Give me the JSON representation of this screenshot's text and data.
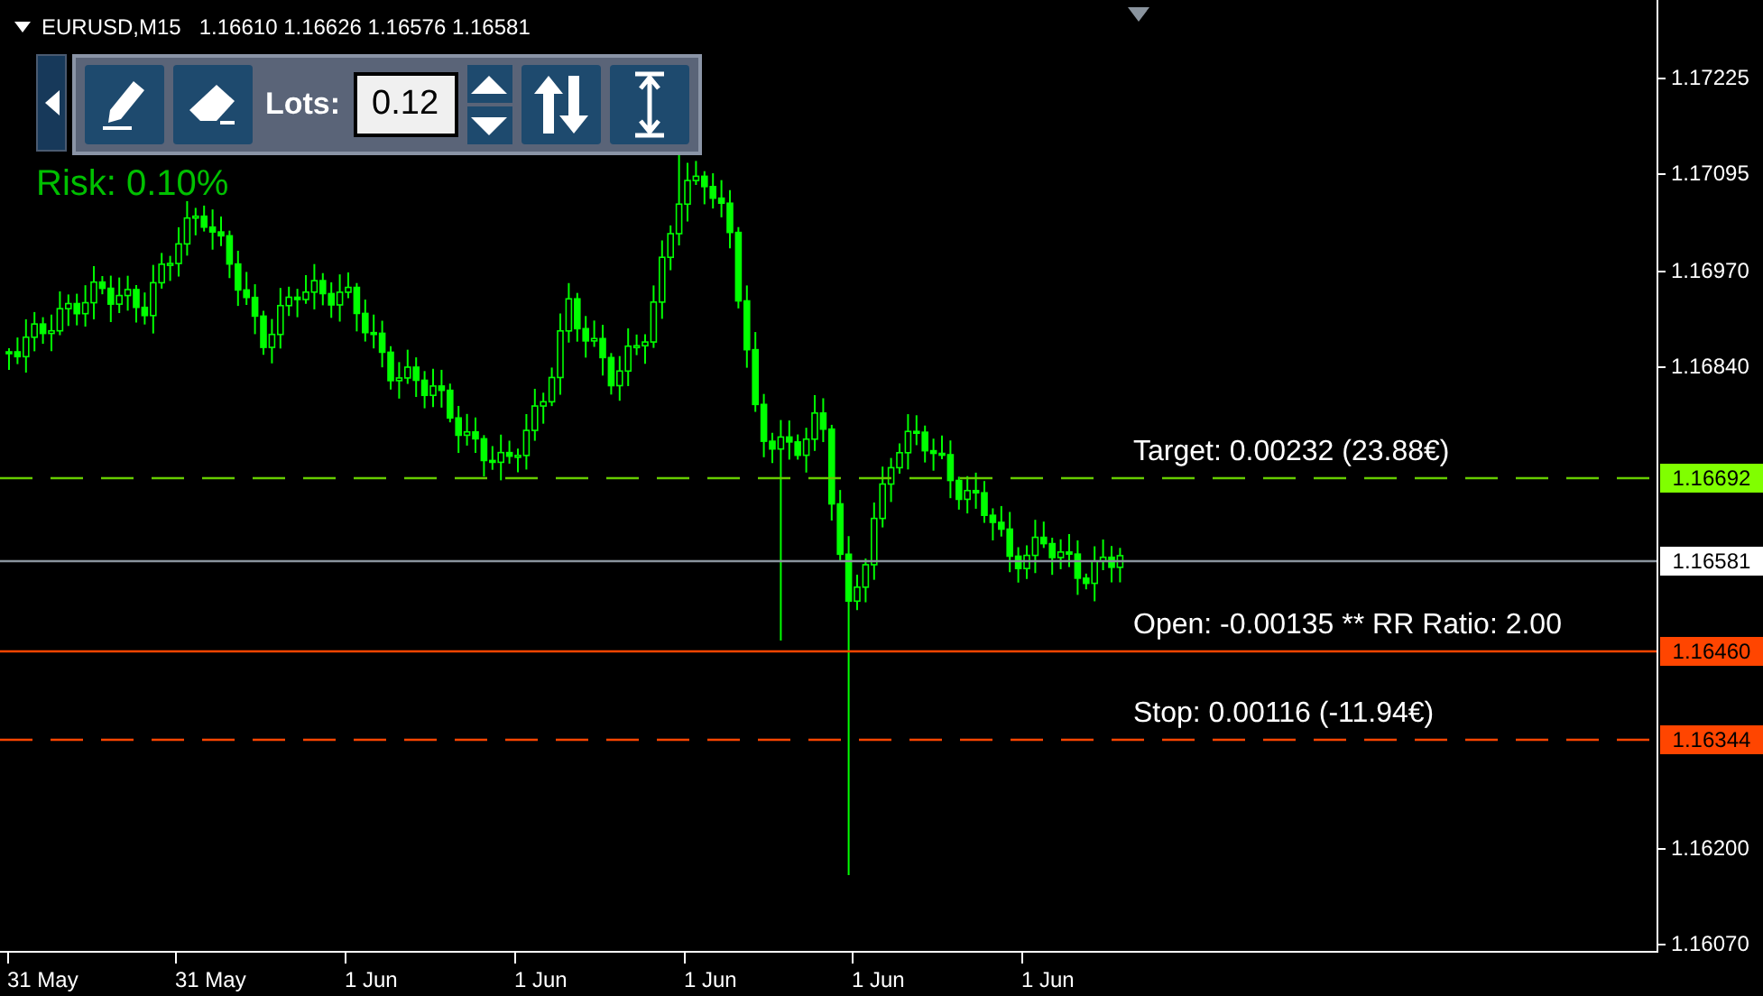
{
  "header": {
    "symbol": "EURUSD,M15",
    "quotes": "1.16610 1.16626 1.16576 1.16581"
  },
  "toolbar": {
    "lots_label": "Lots:",
    "lots_value": "0.12"
  },
  "risk": "Risk: 0.10%",
  "price_axis": [
    "1.17225",
    "1.17095",
    "1.16970",
    "1.16840",
    "1.16200",
    "1.16070"
  ],
  "time_axis": [
    "31 May",
    "31 May",
    "1 Jun",
    "1 Jun",
    "1 Jun",
    "1 Jun",
    "1 Jun"
  ],
  "levels": [
    {
      "kind": "target",
      "label": "Target: 0.00232 (23.88€)",
      "price": "1.16692",
      "color": "#80ff00"
    },
    {
      "kind": "current",
      "price": "1.16581",
      "color": "#ffffff"
    },
    {
      "kind": "open",
      "label": "Open: -0.00135 ** RR Ratio: 2.00",
      "price": "1.16460",
      "color": "#ff4500"
    },
    {
      "kind": "stop",
      "label": "Stop: 0.00116 (-11.94€)",
      "price": "1.16344",
      "color": "#ff4500"
    }
  ]
}
